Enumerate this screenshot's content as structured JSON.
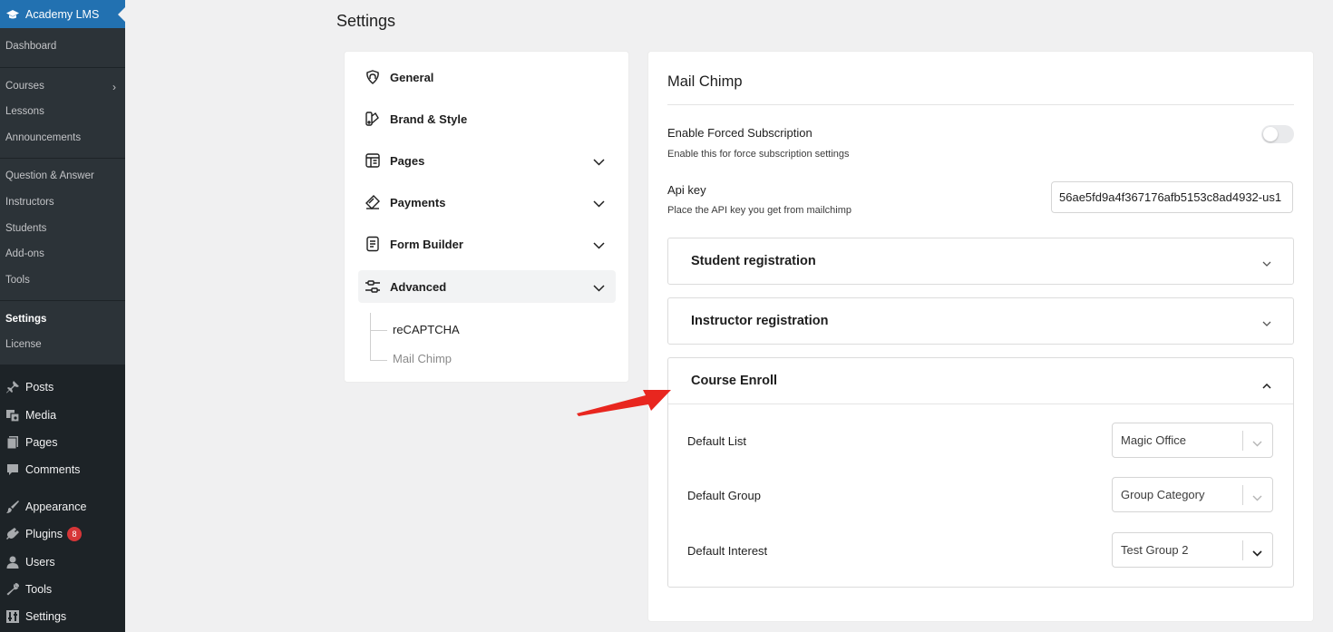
{
  "sidebar": {
    "plugin_title": "Academy LMS",
    "submenu": [
      {
        "label": "Dashboard"
      },
      {
        "label": "Courses"
      },
      {
        "label": "Lessons"
      },
      {
        "label": "Announcements"
      },
      {
        "label": "Question & Answer"
      },
      {
        "label": "Instructors"
      },
      {
        "label": "Students"
      },
      {
        "label": "Add-ons"
      },
      {
        "label": "Tools"
      },
      {
        "label": "Settings"
      },
      {
        "label": "License"
      }
    ],
    "current_submenu": "Settings",
    "main_menu": [
      {
        "label": "Posts",
        "icon": "pin-icon"
      },
      {
        "label": "Media",
        "icon": "media-icon"
      },
      {
        "label": "Pages",
        "icon": "pages-icon"
      },
      {
        "label": "Comments",
        "icon": "comment-icon"
      },
      {
        "label": "Appearance",
        "icon": "brush-icon"
      },
      {
        "label": "Plugins",
        "icon": "plug-icon",
        "badge": "8"
      },
      {
        "label": "Users",
        "icon": "user-icon"
      },
      {
        "label": "Tools",
        "icon": "wrench-icon"
      },
      {
        "label": "Settings",
        "icon": "settings-icon"
      }
    ]
  },
  "page": {
    "title": "Settings"
  },
  "settings_nav": {
    "items": [
      {
        "label": "General",
        "icon": "general-icon"
      },
      {
        "label": "Brand & Style",
        "icon": "brand-style-icon"
      },
      {
        "label": "Pages",
        "icon": "pages-icon"
      },
      {
        "label": "Payments",
        "icon": "payments-icon"
      },
      {
        "label": "Form Builder",
        "icon": "form-builder-icon"
      },
      {
        "label": "Advanced",
        "icon": "advanced-icon"
      }
    ],
    "active": "Advanced",
    "sub_items": [
      {
        "label": "reCAPTCHA"
      },
      {
        "label": "Mail Chimp"
      }
    ],
    "active_sub": "Mail Chimp"
  },
  "mailchimp": {
    "title": "Mail Chimp",
    "forced_subscription": {
      "label": "Enable Forced Subscription",
      "help": "Enable this for force subscription settings",
      "enabled": false
    },
    "api_key": {
      "label": "Api key",
      "help": "Place the API key you get from mailchimp",
      "value": "56ae5fd9a4f367176afb5153c8ad4932-us1"
    },
    "sections": [
      {
        "title": "Student registration",
        "expanded": false
      },
      {
        "title": "Instructor registration",
        "expanded": false
      },
      {
        "title": "Course Enroll",
        "expanded": true
      }
    ],
    "course_enroll": {
      "default_list": {
        "label": "Default List",
        "value": "Magic Office"
      },
      "default_group": {
        "label": "Default Group",
        "value": "Group Category"
      },
      "default_interest": {
        "label": "Default Interest",
        "value": "Test Group 2"
      }
    }
  },
  "colors": {
    "sidebar_bg": "#1d2327",
    "submenu_bg": "#2c3338",
    "plugin_header": "#2271b1",
    "badge": "#d63638",
    "annotation_arrow": "#e8261f"
  }
}
